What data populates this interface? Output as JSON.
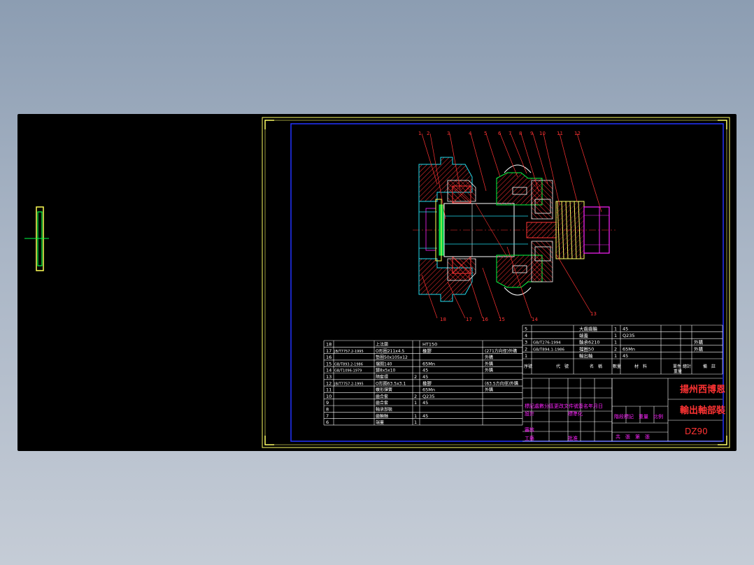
{
  "drawing": {
    "title_cn_1": "揚州西博恩",
    "title_cn_2": "輸出軸部裝",
    "drawing_no": "DZ90",
    "colors": {
      "background": "#000000",
      "frame": "#2233ff",
      "border": "#ffff66",
      "outline": "#ffffff",
      "hatch": "#ff3333",
      "green": "#00ff44",
      "cyan": "#22ddee",
      "magenta": "#ff22ff",
      "title_red": "#ff3333"
    }
  },
  "balloons": [
    "1",
    "2",
    "3",
    "4",
    "5",
    "6",
    "7",
    "8",
    "9",
    "10",
    "11",
    "12",
    "13",
    "14",
    "15",
    "16",
    "17",
    "18"
  ],
  "top_bom": [
    {
      "no": "5",
      "name": "大齒齒輪",
      "qty": "1",
      "mat": "45",
      "note": ""
    },
    {
      "no": "4",
      "name": "端蓋",
      "qty": "1",
      "mat": "Q235",
      "note": ""
    },
    {
      "no": "3",
      "code": "GB/T276-1994",
      "name": "軸承6210",
      "qty": "1",
      "mat": "",
      "note": "外購"
    },
    {
      "no": "2",
      "code": "GB/T894.1-1986",
      "name": "擋圈50",
      "qty": "2",
      "mat": "65Mn",
      "note": "外購"
    },
    {
      "no": "1",
      "name": "輸出軸",
      "qty": "1",
      "mat": "45",
      "note": ""
    }
  ],
  "top_bom_header": [
    "序號",
    "代　號",
    "名　稱",
    "數量",
    "材　料",
    "單件",
    "總計",
    "備　註"
  ],
  "top_bom_header2": [
    "重量"
  ],
  "left_bom": [
    {
      "no": "18",
      "code": "",
      "name": "上法蘭",
      "qty": "",
      "mat": "HT150",
      "note": ""
    },
    {
      "no": "17",
      "code": "JB/T7757.2-1995",
      "name": "O形圈211x4.5",
      "qty": "",
      "mat": "橡膠",
      "note": "(271方向徑)外購"
    },
    {
      "no": "16",
      "code": "",
      "name": "墊圈50x105x12",
      "qty": "",
      "mat": "",
      "note": "外購"
    },
    {
      "no": "15",
      "code": "GB/T893.2-1986",
      "name": "擋圈140",
      "qty": "",
      "mat": "65Mn",
      "note": "外購"
    },
    {
      "no": "14",
      "code": "GB/T1096-1979",
      "name": "鍵8x5x10",
      "qty": "",
      "mat": "45",
      "note": "外購"
    },
    {
      "no": "13",
      "code": "",
      "name": "隔套環",
      "qty": "2",
      "mat": "45",
      "note": ""
    },
    {
      "no": "12",
      "code": "JB/T7757.2-1995",
      "name": "O形圈63.5x3.1",
      "qty": "",
      "mat": "橡膠",
      "note": "(63.5方向徑)外購"
    },
    {
      "no": "11",
      "code": "",
      "name": "蝶形彈簧",
      "qty": "",
      "mat": "65Mn",
      "note": "外購"
    },
    {
      "no": "10",
      "code": "",
      "name": "齒合套",
      "qty": "2",
      "mat": "Q235",
      "note": ""
    },
    {
      "no": "9",
      "code": "",
      "name": "齒合套",
      "qty": "1",
      "mat": "45",
      "note": ""
    },
    {
      "no": "8",
      "code": "",
      "name": "軸承部裝",
      "qty": "",
      "mat": "",
      "note": ""
    },
    {
      "no": "7",
      "code": "",
      "name": "齒輪軸",
      "qty": "1",
      "mat": "45",
      "note": ""
    },
    {
      "no": "6",
      "code": "",
      "name": "端蓋",
      "qty": "1",
      "mat": "",
      "note": ""
    }
  ],
  "title_block": {
    "revision_row": "標記處數分區更改文件號簽名年月日",
    "design": "設計",
    "standard": "標準化",
    "stage_row": "階段標記　重量　比例",
    "check": "審核",
    "craft": "工藝",
    "approve": "批准",
    "sheets": "共　張　第　張"
  }
}
